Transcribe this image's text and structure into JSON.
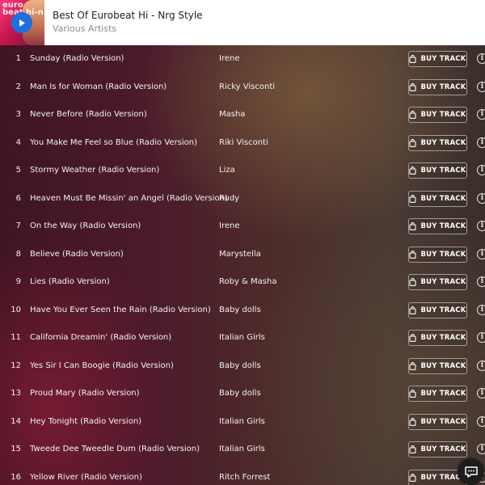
{
  "header": {
    "album_title": "Best Of Eurobeat Hi - Nrg Style",
    "artist": "Various Artists",
    "cover_text": "euro beat hi-n",
    "play_icon": "play-icon"
  },
  "buy_label": "BUY TRACK",
  "colors": {
    "play_button": "#1e6fe0",
    "header_bg": "#ffffff",
    "row_text": "#f2f2f2"
  },
  "tracks": [
    {
      "num": "1",
      "title": "Sunday (Radio Version)",
      "artist": "Irene"
    },
    {
      "num": "2",
      "title": "Man Is for Woman (Radio Version)",
      "artist": "Ricky Visconti"
    },
    {
      "num": "3",
      "title": "Never Before (Radio Version)",
      "artist": "Masha"
    },
    {
      "num": "4",
      "title": "You Make Me Feel so Blue (Radio Version)",
      "artist": "Riki Visconti"
    },
    {
      "num": "5",
      "title": "Stormy Weather (Radio Version)",
      "artist": "Liza"
    },
    {
      "num": "6",
      "title": "Heaven Must Be Missin' an Angel (Radio Version)",
      "artist": "Rudy"
    },
    {
      "num": "7",
      "title": "On the Way (Radio Version)",
      "artist": "Irene"
    },
    {
      "num": "8",
      "title": "Believe (Radio Version)",
      "artist": "Marystella"
    },
    {
      "num": "9",
      "title": "Lies (Radio Version)",
      "artist": "Roby & Masha"
    },
    {
      "num": "10",
      "title": "Have You Ever Seen the Rain (Radio Version)",
      "artist": "Baby dolls"
    },
    {
      "num": "11",
      "title": "California Dreamin' (Radio Version)",
      "artist": "Italian Girls"
    },
    {
      "num": "12",
      "title": "Yes Sir I Can Boogie (Radio Version)",
      "artist": "Baby dolls"
    },
    {
      "num": "13",
      "title": "Proud Mary (Radio Version)",
      "artist": "Baby dolls"
    },
    {
      "num": "14",
      "title": "Hey Tonight (Radio Version)",
      "artist": "Italian Girls"
    },
    {
      "num": "15",
      "title": "Tweede Dee Tweedle Dum (Radio Version)",
      "artist": "Italian Girls"
    },
    {
      "num": "16",
      "title": "Yellow River (Radio Version)",
      "artist": "Ritch Forrest"
    }
  ]
}
